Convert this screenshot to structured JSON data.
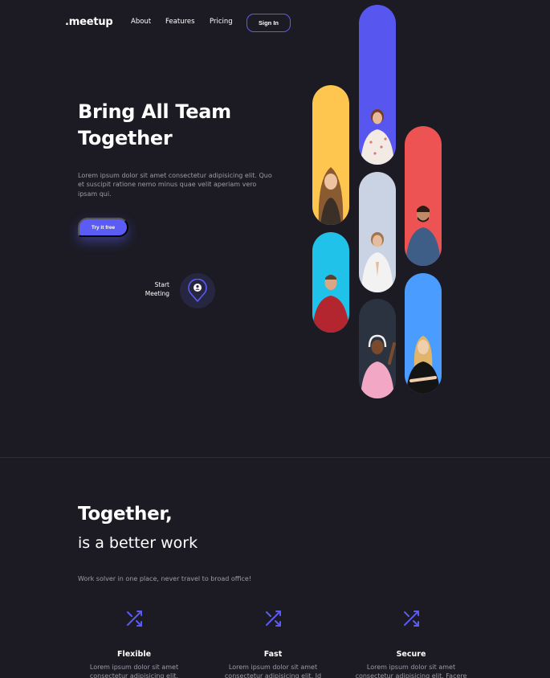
{
  "nav": {
    "logo": ".meetup",
    "links": [
      "About",
      "Features",
      "Pricing"
    ],
    "signin": "Sign In"
  },
  "hero": {
    "title_line1": "Bring All Team",
    "title_line2": "Together",
    "description": "Lorem ipsum dolor sit amet consectetur adipisicing elit. Quo et suscipit ratione nemo minus quae velit aperiam vero ipsam qui.",
    "cta": "Try it free",
    "meeting_line1": "Start",
    "meeting_line2": "Meeting"
  },
  "gallery": [
    {
      "name": "woman-wavy-hair",
      "color": "#5757f0"
    },
    {
      "name": "woman-long-hair",
      "color": "#fec54f"
    },
    {
      "name": "man-beard",
      "color": "#ee5354"
    },
    {
      "name": "woman-namaste",
      "color": "#c9d3e3"
    },
    {
      "name": "man-earphones",
      "color": "#20c2e9"
    },
    {
      "name": "woman-headphones",
      "color": "#2b3240"
    },
    {
      "name": "woman-arms-crossed",
      "color": "#4a9cff"
    }
  ],
  "section2": {
    "title": "Together,",
    "subtitle": "is a better work",
    "description": "Work solver in one place, never travel to broad office!",
    "features": [
      {
        "name": "Flexible",
        "text": "Lorem ipsum dolor sit amet consectetur adipisicing elit.",
        "icon": "shuffle-icon"
      },
      {
        "name": "Fast",
        "text": "Lorem ipsum dolor sit amet consectetur adipisicing elit. Id",
        "icon": "shuffle-icon"
      },
      {
        "name": "Secure",
        "text": "Lorem ipsum dolor sit amet consectetur adipisicing elit. Facere",
        "icon": "shuffle-icon"
      }
    ]
  },
  "colors": {
    "background": "#1c1b24",
    "accent": "#5b5bf5",
    "muted_text": "#9d9ba8"
  }
}
